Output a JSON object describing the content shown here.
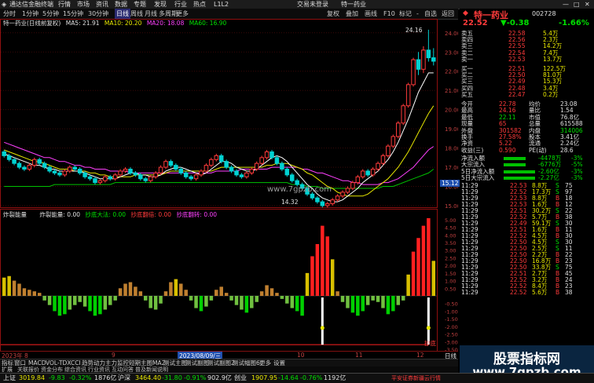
{
  "titlebar": {
    "app": "通达信金融终端",
    "menus": [
      "行情",
      "市场",
      "资讯",
      "数据",
      "专题",
      "发现",
      "行业",
      "热点",
      "L1L2"
    ],
    "login": "交易未登录",
    "stock": "特一药业",
    "win_btns": [
      "—",
      "□",
      "✕"
    ]
  },
  "toolbar": {
    "periods": [
      "分时",
      "1分钟",
      "5分钟",
      "15分钟",
      "30分钟",
      "60分钟",
      "日线",
      "周线",
      "月线",
      "多周期",
      "更多"
    ],
    "right": [
      "复权",
      "叠加",
      "画线",
      "F10",
      "标记",
      "-",
      "自选",
      "返回"
    ]
  },
  "chart": {
    "legend": {
      "name": "特一药业(日线前复权)",
      "ma5": "MA5: 21.91",
      "ma10": "MA10: 20.20",
      "ma20": "MA20: 18.08",
      "ma60": "MA60: 16.90"
    },
    "y_labels": [
      "24.00",
      "23.00",
      "22.00",
      "21.00",
      "20.00",
      "19.00",
      "18.00",
      "17.00",
      "16.00",
      "15.00"
    ],
    "price_box": "15.12",
    "high_annot": "24.16",
    "low_annot": "14.32",
    "watermark": "www.7gpzb.com",
    "sub_legend": {
      "name": "炸裂能量",
      "label": "炸裂能量: 0.00",
      "a": "抄底大法: 0.00",
      "b": "抄底翻倍: 0.00",
      "c": "抄底翻转: 0.00"
    },
    "sub_y_labels": [
      "5.00",
      "4.50",
      "4.00",
      "3.50",
      "3.00",
      "2.50",
      "2.00",
      "1.50",
      "1.00",
      "0.50",
      "-0.50",
      "-1.00",
      "-1.50",
      "-2.00",
      "-2.50",
      "-3.00",
      "-3.50"
    ],
    "sub_annot": "抄底",
    "date_labels": [
      "2023年 8",
      "9",
      "2023/08/09/三",
      "10",
      "11",
      "12"
    ],
    "date_right": "日线"
  },
  "chart_data": {
    "type": "candlestick",
    "ylim": [
      15,
      24.4
    ],
    "candles": [
      [
        17.8,
        17.6,
        17.9,
        17.5
      ],
      [
        17.6,
        17.4,
        17.7,
        17.3
      ],
      [
        17.4,
        17.2,
        17.5,
        17.1
      ],
      [
        17.2,
        17.0,
        17.3,
        16.9
      ],
      [
        17.0,
        16.9,
        17.1,
        16.8
      ],
      [
        16.9,
        17.1,
        17.2,
        16.8
      ],
      [
        17.1,
        17.4,
        17.5,
        17.0
      ],
      [
        17.4,
        17.2,
        17.5,
        17.1
      ],
      [
        17.2,
        17.0,
        17.3,
        16.9
      ],
      [
        17.0,
        16.8,
        17.1,
        16.7
      ],
      [
        16.8,
        16.7,
        16.9,
        16.6
      ],
      [
        16.7,
        16.6,
        16.8,
        16.5
      ],
      [
        16.6,
        16.8,
        16.9,
        16.5
      ],
      [
        16.8,
        17.0,
        17.1,
        16.7
      ],
      [
        17.0,
        16.9,
        17.1,
        16.8
      ],
      [
        16.9,
        16.7,
        17.0,
        16.6
      ],
      [
        16.7,
        16.5,
        16.8,
        16.4
      ],
      [
        16.5,
        16.4,
        16.6,
        16.3
      ],
      [
        16.4,
        16.2,
        16.5,
        16.1
      ],
      [
        16.2,
        16.3,
        16.4,
        16.1
      ],
      [
        16.3,
        16.5,
        16.6,
        16.2
      ],
      [
        16.5,
        16.4,
        16.6,
        16.3
      ],
      [
        16.4,
        16.6,
        16.7,
        16.3
      ],
      [
        16.6,
        16.8,
        16.9,
        16.5
      ],
      [
        16.8,
        16.9,
        17.0,
        16.7
      ],
      [
        16.9,
        16.7,
        17.0,
        16.6
      ],
      [
        16.7,
        16.6,
        16.8,
        16.5
      ],
      [
        16.6,
        16.4,
        16.7,
        16.3
      ],
      [
        16.4,
        16.3,
        16.5,
        16.2
      ],
      [
        16.3,
        16.5,
        16.6,
        16.2
      ],
      [
        16.5,
        16.7,
        16.8,
        16.4
      ],
      [
        16.7,
        17.0,
        17.1,
        16.6
      ],
      [
        17.0,
        17.3,
        17.4,
        16.9
      ],
      [
        17.3,
        17.1,
        17.4,
        17.0
      ],
      [
        17.1,
        16.9,
        17.2,
        16.8
      ],
      [
        16.9,
        16.7,
        17.0,
        16.6
      ],
      [
        16.7,
        16.5,
        16.8,
        16.4
      ],
      [
        16.5,
        16.4,
        16.6,
        16.3
      ],
      [
        16.4,
        16.6,
        16.7,
        16.3
      ],
      [
        16.6,
        16.8,
        16.9,
        16.5
      ],
      [
        16.8,
        17.1,
        17.2,
        16.7
      ],
      [
        17.1,
        17.4,
        17.5,
        17.0
      ],
      [
        17.4,
        17.6,
        17.7,
        17.3
      ],
      [
        17.6,
        17.3,
        17.7,
        17.2
      ],
      [
        17.3,
        17.0,
        17.4,
        16.9
      ],
      [
        17.0,
        16.8,
        17.1,
        16.7
      ],
      [
        16.8,
        16.6,
        16.9,
        16.5
      ],
      [
        16.6,
        16.5,
        16.7,
        16.4
      ],
      [
        16.5,
        16.7,
        16.8,
        16.4
      ],
      [
        16.7,
        16.9,
        17.0,
        16.6
      ],
      [
        16.9,
        17.2,
        17.3,
        16.8
      ],
      [
        17.2,
        17.5,
        17.6,
        17.1
      ],
      [
        17.5,
        17.8,
        17.9,
        17.4
      ],
      [
        17.8,
        17.5,
        17.9,
        17.4
      ],
      [
        17.5,
        17.2,
        17.6,
        17.1
      ],
      [
        17.2,
        16.9,
        17.3,
        16.8
      ],
      [
        16.9,
        16.6,
        17.0,
        16.5
      ],
      [
        16.6,
        16.3,
        16.7,
        16.2
      ],
      [
        16.3,
        16.1,
        16.4,
        16.0
      ],
      [
        16.1,
        15.9,
        16.2,
        15.8
      ],
      [
        15.9,
        15.6,
        16.0,
        15.5
      ],
      [
        15.6,
        15.4,
        15.7,
        15.3
      ],
      [
        15.4,
        15.2,
        15.5,
        15.1
      ],
      [
        15.2,
        15.0,
        15.3,
        14.9
      ],
      [
        15.0,
        15.1,
        15.2,
        14.9
      ],
      [
        15.1,
        15.3,
        15.4,
        15.0
      ],
      [
        15.3,
        15.5,
        15.6,
        15.2
      ],
      [
        15.5,
        15.7,
        15.8,
        15.4
      ],
      [
        15.7,
        15.9,
        16.0,
        15.6
      ],
      [
        15.9,
        16.2,
        16.3,
        15.8
      ],
      [
        16.2,
        16.5,
        16.6,
        16.1
      ],
      [
        16.5,
        16.8,
        16.9,
        16.4
      ],
      [
        16.8,
        16.6,
        16.9,
        16.5
      ],
      [
        16.6,
        16.9,
        17.0,
        16.5
      ],
      [
        16.9,
        17.2,
        17.3,
        16.8
      ],
      [
        17.2,
        17.6,
        17.7,
        17.1
      ],
      [
        17.6,
        18.1,
        18.2,
        17.5
      ],
      [
        18.1,
        18.6,
        18.7,
        18.0
      ],
      [
        18.6,
        19.3,
        19.4,
        18.5
      ],
      [
        19.3,
        20.2,
        20.3,
        19.2
      ],
      [
        20.2,
        21.3,
        21.4,
        20.1
      ],
      [
        21.3,
        22.6,
        22.7,
        21.2
      ],
      [
        22.6,
        22.1,
        23.0,
        21.8
      ],
      [
        22.1,
        23.1,
        23.3,
        21.9
      ],
      [
        23.1,
        22.7,
        24.16,
        22.5
      ],
      [
        22.7,
        22.52,
        23.2,
        22.3
      ]
    ],
    "ma5": [
      17.7,
      17.6,
      17.5,
      17.4,
      17.3,
      17.2,
      17.1,
      17.1,
      17.0,
      16.9,
      16.9,
      16.8,
      16.8,
      16.8,
      16.8,
      16.8,
      16.7,
      16.6,
      16.5,
      16.4,
      16.4,
      16.4,
      16.4,
      16.5,
      16.6,
      16.7,
      16.7,
      16.6,
      16.6,
      16.5,
      16.5,
      16.6,
      16.8,
      16.9,
      17.0,
      17.0,
      16.9,
      16.8,
      16.7,
      16.6,
      16.7,
      16.9,
      17.1,
      17.3,
      17.3,
      17.2,
      17.0,
      16.9,
      16.8,
      16.8,
      16.9,
      17.1,
      17.3,
      17.5,
      17.6,
      17.5,
      17.3,
      17.0,
      16.7,
      16.4,
      16.1,
      15.9,
      15.6,
      15.4,
      15.3,
      15.2,
      15.2,
      15.3,
      15.5,
      15.7,
      15.9,
      16.2,
      16.4,
      16.6,
      16.8,
      17.1,
      17.4,
      17.8,
      18.3,
      18.9,
      19.5,
      20.2,
      20.9,
      21.4,
      21.91,
      21.91
    ],
    "ma10": [
      17.9,
      17.8,
      17.7,
      17.6,
      17.5,
      17.4,
      17.3,
      17.3,
      17.2,
      17.1,
      17.0,
      16.9,
      16.9,
      16.9,
      16.8,
      16.8,
      16.8,
      16.7,
      16.7,
      16.6,
      16.6,
      16.5,
      16.5,
      16.5,
      16.5,
      16.5,
      16.6,
      16.6,
      16.6,
      16.6,
      16.6,
      16.6,
      16.7,
      16.8,
      16.8,
      16.8,
      16.8,
      16.8,
      16.8,
      16.8,
      16.8,
      16.8,
      16.9,
      17.0,
      17.0,
      17.0,
      17.0,
      17.0,
      17.0,
      17.0,
      17.0,
      17.0,
      17.1,
      17.1,
      17.2,
      17.2,
      17.2,
      17.1,
      17.0,
      16.9,
      16.7,
      16.6,
      16.4,
      16.2,
      16.0,
      15.9,
      15.7,
      15.6,
      15.5,
      15.5,
      15.5,
      15.5,
      15.6,
      15.8,
      16.0,
      16.2,
      16.4,
      16.7,
      17.0,
      17.4,
      17.8,
      18.3,
      18.8,
      19.3,
      19.8,
      20.2
    ],
    "ma20": [
      18.3,
      18.2,
      18.1,
      18.0,
      17.9,
      17.8,
      17.7,
      17.6,
      17.5,
      17.5,
      17.4,
      17.3,
      17.3,
      17.2,
      17.1,
      17.1,
      17.0,
      17.0,
      16.9,
      16.9,
      16.9,
      16.8,
      16.8,
      16.8,
      16.8,
      16.7,
      16.7,
      16.7,
      16.7,
      16.7,
      16.7,
      16.7,
      16.7,
      16.7,
      16.7,
      16.7,
      16.7,
      16.7,
      16.7,
      16.7,
      16.7,
      16.7,
      16.8,
      16.8,
      16.8,
      16.8,
      16.8,
      16.9,
      16.9,
      16.9,
      16.9,
      16.9,
      16.9,
      17.0,
      17.0,
      17.0,
      17.0,
      17.0,
      17.0,
      16.9,
      16.9,
      16.8,
      16.7,
      16.7,
      16.6,
      16.5,
      16.4,
      16.3,
      16.3,
      16.2,
      16.2,
      16.1,
      16.1,
      16.1,
      16.1,
      16.2,
      16.2,
      16.3,
      16.4,
      16.6,
      16.8,
      17.0,
      17.3,
      17.6,
      17.9,
      18.08
    ],
    "ma60": [
      16.0,
      16.0,
      16.0,
      16.0,
      16.0,
      16.0,
      16.0,
      16.0,
      16.0,
      16.0,
      16.1,
      16.1,
      16.1,
      16.1,
      16.1,
      16.1,
      16.1,
      16.1,
      16.1,
      16.1,
      16.1,
      16.1,
      16.2,
      16.2,
      16.2,
      16.2,
      16.2,
      16.2,
      16.2,
      16.2,
      16.2,
      16.2,
      16.2,
      16.2,
      16.2,
      16.2,
      16.2,
      16.2,
      16.2,
      16.2,
      16.2,
      16.2,
      16.2,
      16.2,
      16.2,
      16.2,
      16.2,
      16.2,
      16.2,
      16.2,
      16.2,
      16.2,
      16.2,
      16.2,
      16.2,
      16.2,
      16.2,
      16.1,
      16.1,
      16.1,
      16.0,
      16.0,
      16.0,
      15.9,
      15.9,
      15.9,
      15.9,
      15.9,
      15.9,
      15.9,
      15.9,
      15.9,
      15.9,
      15.9,
      15.9,
      16.0,
      16.0,
      16.0,
      16.1,
      16.2,
      16.3,
      16.4,
      16.5,
      16.6,
      16.7,
      16.9
    ],
    "sub": [
      1.2,
      1.3,
      1.0,
      0.8,
      0.5,
      0.4,
      0.3,
      0.2,
      -0.3,
      -0.6,
      -1.0,
      -1.3,
      -1.2,
      -0.9,
      -0.6,
      -0.4,
      -0.7,
      -1.0,
      -1.3,
      -1.2,
      -0.9,
      -0.6,
      -0.3,
      0.5,
      0.8,
      0.9,
      0.6,
      0.3,
      -0.3,
      -0.8,
      -0.9,
      -0.5,
      0.3,
      0.9,
      1.1,
      0.8,
      0.4,
      -0.3,
      -0.8,
      -1.0,
      -0.7,
      -0.3,
      0.4,
      0.6,
      0.2,
      -0.3,
      -0.6,
      -0.9,
      -1.1,
      -0.8,
      -0.4,
      0.3,
      0.7,
      0.5,
      0.2,
      -0.2,
      -0.5,
      -0.8,
      -1.0,
      -1.3,
      1.5,
      2.6,
      3.4,
      4.6,
      3.9,
      2.4,
      0.3,
      -0.4,
      -0.8,
      -1.1,
      -1.3,
      -1.0,
      -0.6,
      -0.3,
      -0.4,
      -0.8,
      -1.2,
      -1.0,
      -0.6,
      -0.3,
      1.4,
      2.9,
      3.8,
      4.6,
      5.1,
      2.3
    ],
    "sub_ylim": [
      -3.5,
      5.2
    ]
  },
  "quote": {
    "code_name": "特一药业",
    "code": "002728",
    "price": "22.52",
    "change": "▼-0.38",
    "pct": "-1.66%",
    "sells": [
      [
        "卖五",
        "22.58",
        "5.4万"
      ],
      [
        "卖四",
        "22.56",
        "2.3万"
      ],
      [
        "卖三",
        "22.55",
        "14.2万"
      ],
      [
        "卖二",
        "22.54",
        "7.4万"
      ],
      [
        "卖一",
        "22.53",
        "13.7万"
      ]
    ],
    "buys": [
      [
        "买一",
        "22.51",
        "122.5万"
      ],
      [
        "买二",
        "22.50",
        "81.0万"
      ],
      [
        "买三",
        "22.49",
        "15.3万"
      ],
      [
        "买四",
        "22.48",
        "3.4万"
      ],
      [
        "买五",
        "22.47",
        "0.2万"
      ]
    ],
    "stats": [
      [
        "今开",
        "22.78",
        "均价",
        "23.08"
      ],
      [
        "最高",
        "24.16",
        "量比",
        "1.54"
      ],
      [
        "最低",
        "22.11",
        "市值",
        "76.8亿"
      ],
      [
        "现量",
        "65",
        "总量",
        "615588"
      ],
      [
        "外盘",
        "301582",
        "内盘",
        "314006"
      ],
      [
        "换手",
        "27.58%",
        "股本",
        "3.41亿"
      ],
      [
        "净资",
        "5.22",
        "流通",
        "2.24亿"
      ],
      [
        "收益(三)",
        "0.590",
        "PE(动)",
        "28.6"
      ]
    ],
    "flows": [
      [
        "净流入额",
        "-4478万",
        "-3%"
      ],
      [
        "大宗流入",
        "-6776万",
        "-5%"
      ],
      [
        "5日净流入额",
        "-2.60亿",
        "-3%"
      ],
      [
        "5日大宗流入",
        "-2.27亿",
        "-3%"
      ]
    ],
    "ticks": [
      [
        "11:29",
        "22.53",
        "8.8万",
        "S",
        "75"
      ],
      [
        "11:29",
        "22.52",
        "17.3万",
        "S",
        "97"
      ],
      [
        "11:29",
        "22.53",
        "8.8万",
        "B",
        "18"
      ],
      [
        "11:29",
        "22.53",
        "1.6万",
        "B",
        "12"
      ],
      [
        "11:29",
        "22.51",
        "30.2万",
        "S",
        "22"
      ],
      [
        "11:29",
        "22.52",
        "5.7万",
        "B",
        "38"
      ],
      [
        "11:29",
        "22.49",
        "59.1万",
        "S",
        "30"
      ],
      [
        "11:29",
        "22.51",
        "1.6万",
        "B",
        "11"
      ],
      [
        "11:29",
        "22.52",
        "4.5万",
        "B",
        "30"
      ],
      [
        "11:29",
        "22.50",
        "4.5万",
        "S",
        "30"
      ],
      [
        "11:29",
        "22.50",
        "2.5万",
        "S",
        "11"
      ],
      [
        "11:29",
        "22.50",
        "2.2万",
        "B",
        "22"
      ],
      [
        "11:29",
        "22.50",
        "16.8万",
        "B",
        "23"
      ],
      [
        "11:29",
        "22.50",
        "33.8万",
        "S",
        "75"
      ],
      [
        "11:29",
        "22.51",
        "2.7万",
        "B",
        "45"
      ],
      [
        "11:29",
        "22.52",
        "3.2万",
        "B",
        "24"
      ],
      [
        "11:29",
        "22.52",
        "8.4万",
        "B",
        "23"
      ],
      [
        "11:29",
        "22.52",
        "5.6万",
        "B",
        "38"
      ]
    ]
  },
  "bottomtabs": [
    "指标",
    "窗口",
    "MACD",
    "VOL-TDX",
    "CCI",
    "趋势动力",
    "主力监控",
    "短期主图",
    "MA2",
    "测试主图",
    "测试副图",
    "测试副图2",
    "测试幅图6",
    "更多",
    "设置"
  ],
  "bottomtabs2": [
    "扩展",
    "关联报价",
    "资金分布",
    "综合资讯",
    "行业资讯",
    "互动问答",
    "普及新闻说明"
  ],
  "statusbar": {
    "sh_name": "上证",
    "sh_val": "3019.84",
    "sh_chg": "-9.83",
    "sh_pct": "-0.32%",
    "sh_amt": "1876亿",
    "hs_name": "沪深",
    "hs_val": "3464.40",
    "hs_chg": "-31.80",
    "hs_pct": "-0.91%",
    "hs_amt": "902.9亿",
    "cy_name": "创业",
    "cy_val": "1907.95",
    "cy_chg": "-14.64",
    "cy_pct": "-0.76%",
    "cy_amt": "1192亿",
    "msg": "平安证券新疆云行情"
  },
  "side_watermark": {
    "line1": "股票指标网",
    "line2": "www.7gpzb.com"
  },
  "colors": {
    "up": "#ff3b3b",
    "down": "#00d2d2",
    "ma5": "#ffffff",
    "ma10": "#e8e800",
    "ma20": "#ff40ff",
    "ma60": "#00c000"
  }
}
